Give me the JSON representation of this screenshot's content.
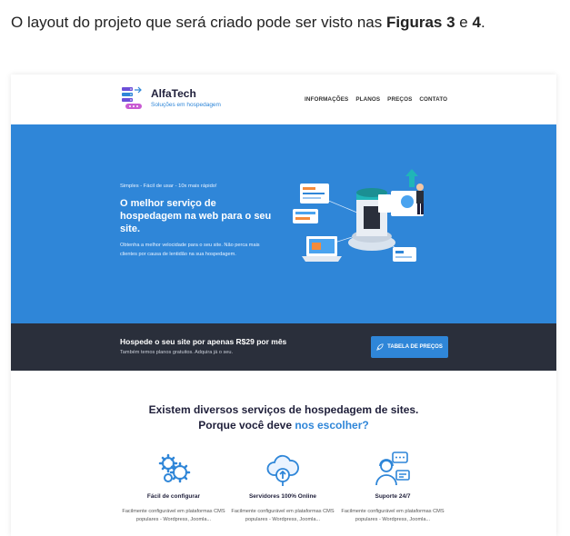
{
  "intro": {
    "part1": "O layout do projeto que será criado pode ser visto nas ",
    "bold1": "Figuras 3",
    "part2": " e ",
    "bold2": "4",
    "part3": "."
  },
  "header": {
    "brand": "AlfaTech",
    "tagline": "Soluções em hospedagem",
    "nav": [
      "INFORMAÇÕES",
      "PLANOS",
      "PREÇOS",
      "CONTATO"
    ]
  },
  "hero": {
    "kicker": "Simples - Fácil de usar - 10x mais rápido!",
    "title": "O melhor serviço de hospedagem na web para o seu site.",
    "text": "Obtenha a melhor velocidade para o seu site. Não perca mais clientes por causa de lentidão na sua hospedagem.",
    "illustration_icon": "server-network-illustration"
  },
  "band": {
    "title": "Hospede o seu site por apenas R$29 por mês",
    "subtitle": "Também temos planos gratuitos. Adquira já o seu.",
    "button_label": "TABELA DE PREÇOS",
    "button_icon": "rocket-icon"
  },
  "why": {
    "line1": "Existem diversos serviços de hospedagem de sites.",
    "line2_prefix": "Porque você deve ",
    "line2_highlight": "nos escolher?"
  },
  "features": [
    {
      "icon": "gears-icon",
      "title": "Fácil de configurar",
      "desc": "Facilmente configurável em plataformas CMS populares - Wordpress, Joomla..."
    },
    {
      "icon": "cloud-upload-icon",
      "title": "Servidores 100% Online",
      "desc": "Facilmente configurável em plataformas CMS populares - Wordpress, Joomla..."
    },
    {
      "icon": "support-agent-icon",
      "title": "Suporte 24/7",
      "desc": "Facilmente configurável em plataformas CMS populares - Wordpress, Joomla..."
    }
  ],
  "colors": {
    "primary": "#2f86d8",
    "dark": "#2a2f3b",
    "text": "#1f1f3a"
  }
}
